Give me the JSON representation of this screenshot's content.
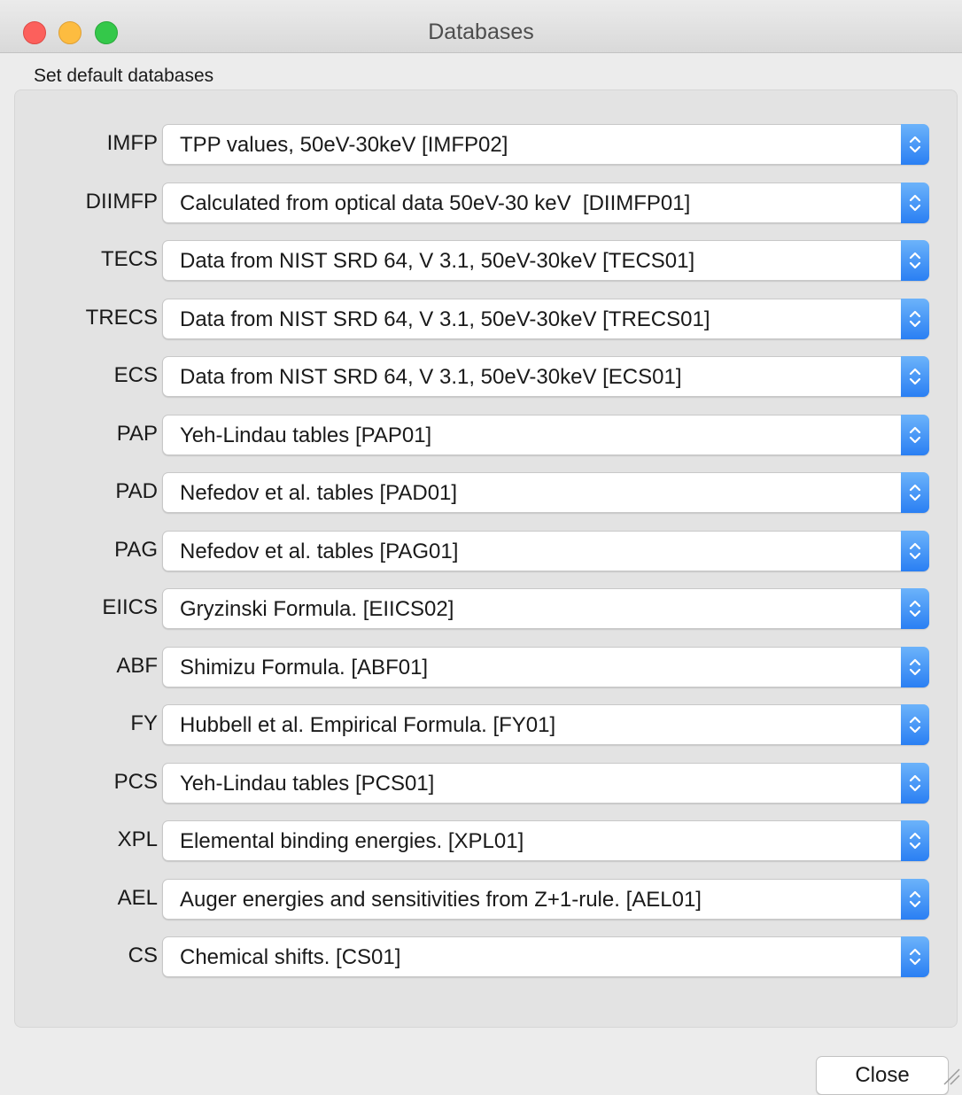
{
  "window": {
    "title": "Databases"
  },
  "group": {
    "label": "Set default databases"
  },
  "rows": [
    {
      "label": "IMFP",
      "value": "TPP values, 50eV-30keV [IMFP02]"
    },
    {
      "label": "DIIMFP",
      "value": "Calculated from optical data 50eV-30 keV  [DIIMFP01]"
    },
    {
      "label": "TECS",
      "value": "Data from NIST SRD 64, V 3.1, 50eV-30keV [TECS01]"
    },
    {
      "label": "TRECS",
      "value": "Data from NIST SRD 64, V 3.1, 50eV-30keV [TRECS01]"
    },
    {
      "label": "ECS",
      "value": "Data from NIST SRD 64, V 3.1, 50eV-30keV [ECS01]"
    },
    {
      "label": "PAP",
      "value": "Yeh-Lindau tables [PAP01]"
    },
    {
      "label": "PAD",
      "value": "Nefedov et al. tables [PAD01]"
    },
    {
      "label": "PAG",
      "value": "Nefedov et al. tables [PAG01]"
    },
    {
      "label": "EIICS",
      "value": "Gryzinski Formula. [EIICS02]"
    },
    {
      "label": "ABF",
      "value": "Shimizu Formula. [ABF01]"
    },
    {
      "label": "FY",
      "value": "Hubbell et al. Empirical Formula. [FY01]"
    },
    {
      "label": "PCS",
      "value": "Yeh-Lindau tables [PCS01]"
    },
    {
      "label": "XPL",
      "value": "Elemental binding energies. [XPL01]"
    },
    {
      "label": "AEL",
      "value": "Auger energies and sensitivities from Z+1-rule. [AEL01]"
    },
    {
      "label": "CS",
      "value": "Chemical shifts. [CS01]"
    }
  ],
  "buttons": {
    "close_label": "Close"
  },
  "icons": {
    "window_close": "close-dot-icon",
    "window_minimize": "minimize-dot-icon",
    "window_zoom": "zoom-dot-icon",
    "combo_arrow": "updown-chevron-icon",
    "resize": "resize-grip-icon"
  },
  "colors": {
    "close_dot": "#fc605c",
    "minimize_dot": "#fdbc40",
    "zoom_dot": "#34c84a",
    "combo_arrow_accent": "#2a7ff3"
  }
}
